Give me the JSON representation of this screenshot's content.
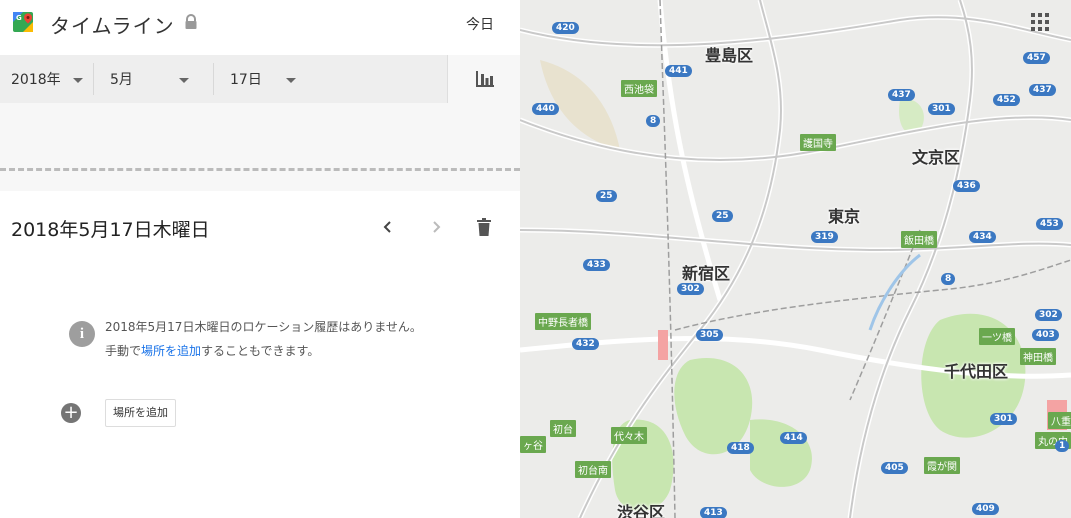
{
  "header": {
    "title": "タイムライン",
    "today_label": "今日"
  },
  "filters": {
    "year": "2018年",
    "month": "5月",
    "day": "17日"
  },
  "day_view": {
    "date_title": "2018年5月17日木曜日",
    "no_history_message": "2018年5月17日木曜日のロケーション履歴はありません。",
    "manual_prefix": "手動で",
    "manual_link": "場所を追加",
    "manual_suffix": "することもできます。",
    "add_place_button": "場所を追加"
  },
  "map": {
    "wards": [
      {
        "name": "toshima",
        "label": "豊島区"
      },
      {
        "name": "bunkyo",
        "label": "文京区"
      },
      {
        "name": "tokyo",
        "label": "東京"
      },
      {
        "name": "shinjuku",
        "label": "新宿区"
      },
      {
        "name": "chiyoda",
        "label": "千代田区"
      },
      {
        "name": "shibuya",
        "label": "渋谷区"
      }
    ],
    "stations": [
      {
        "name": "nishi-ikebukuro",
        "label": "西池袋"
      },
      {
        "name": "gokokuji",
        "label": "護国寺"
      },
      {
        "name": "iidabashi",
        "label": "飯田橋"
      },
      {
        "name": "nakano-sakaue",
        "label": "中野長者橋"
      },
      {
        "name": "hitotsubashi",
        "label": "一ツ橋"
      },
      {
        "name": "jimbocho",
        "label": "神田橋"
      },
      {
        "name": "hatsudai",
        "label": "初台"
      },
      {
        "name": "yoyogi",
        "label": "代々木"
      },
      {
        "name": "hatsudai-minami",
        "label": "初台南"
      },
      {
        "name": "kasumigaseki",
        "label": "霞が関"
      },
      {
        "name": "hatchobori",
        "label": "八重"
      },
      {
        "name": "marunouchi",
        "label": "丸の内"
      },
      {
        "name": "gaya",
        "label": "ヶ谷"
      }
    ],
    "routes": [
      "420",
      "441",
      "437",
      "301",
      "457",
      "452",
      "437",
      "440",
      "8",
      "25",
      "436",
      "25",
      "453",
      "319",
      "434",
      "433",
      "302",
      "8",
      "302",
      "305",
      "403",
      "432",
      "418",
      "414",
      "405",
      "301",
      "413",
      "409",
      "1"
    ]
  },
  "colors": {
    "accent_link": "#1a73e8",
    "station_green": "#6aa84f",
    "route_blue": "#3b78c2",
    "park_green": "#c8e6b0"
  }
}
